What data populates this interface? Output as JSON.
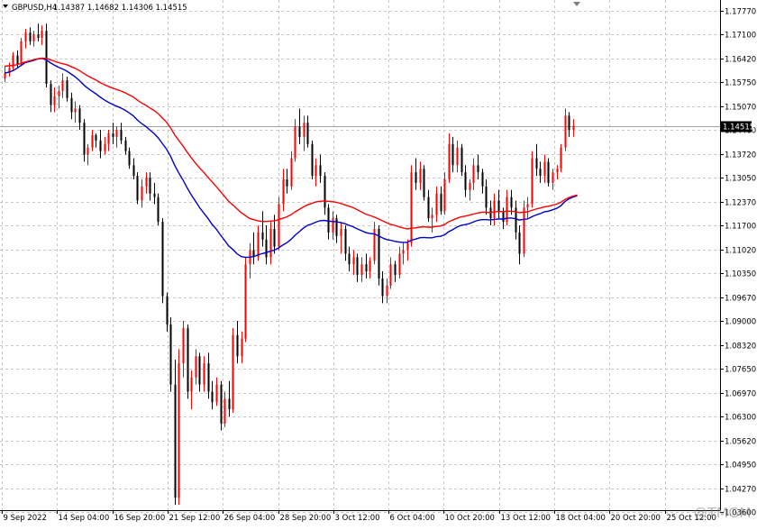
{
  "header": {
    "symbol_timeframe": "GBPUSD,H4",
    "ohlc": "1.14387 1.14682 1.14306 1.14515"
  },
  "watermark": "@TMGM",
  "colors": {
    "bull_candle": "#ff0000",
    "bear_candle": "#000000",
    "ma_fast": "#0000cc",
    "ma_slow": "#ff0000",
    "grid": "#c8c8c8",
    "price_line": "#a0a0a0",
    "price_label_bg": "#000000",
    "price_label_text": "#ffffff"
  },
  "chart_data": {
    "type": "candlestick",
    "symbol": "GBPUSD",
    "timeframe": "H4",
    "current_price": 1.14515,
    "price_label": "1.14515",
    "ylim": [
      1.0365,
      1.1807
    ],
    "y_ticks": [
      "1.17770",
      "1.17100",
      "1.16420",
      "1.15750",
      "1.15070",
      "1.14400",
      "1.13720",
      "1.13050",
      "1.12370",
      "1.11700",
      "1.11020",
      "1.10350",
      "1.09670",
      "1.09000",
      "1.08320",
      "1.07650",
      "1.06970",
      "1.06300",
      "1.05620",
      "1.04950",
      "1.04270",
      "1.03600"
    ],
    "x_labels": [
      "9 Sep 2022",
      "14 Sep 04:00",
      "16 Sep 20:00",
      "21 Sep 12:00",
      "26 Sep 04:00",
      "28 Sep 20:00",
      "3 Oct 12:00",
      "6 Oct 04:00",
      "10 Oct 20:00",
      "13 Oct 12:00",
      "18 Oct 04:00",
      "20 Oct 20:00",
      "25 Oct 12:00"
    ],
    "grid": true,
    "candle_count": 156,
    "candles": [
      [
        1.1585,
        1.162,
        1.1575,
        1.16
      ],
      [
        1.16,
        1.163,
        1.159,
        1.1615
      ],
      [
        1.1615,
        1.166,
        1.161,
        1.165
      ],
      [
        1.165,
        1.1665,
        1.1615,
        1.1625
      ],
      [
        1.1625,
        1.17,
        1.162,
        1.169
      ],
      [
        1.169,
        1.1725,
        1.167,
        1.1715
      ],
      [
        1.1715,
        1.173,
        1.168,
        1.169
      ],
      [
        1.169,
        1.172,
        1.1675,
        1.171
      ],
      [
        1.171,
        1.174,
        1.169,
        1.17
      ],
      [
        1.17,
        1.1735,
        1.168,
        1.172
      ],
      [
        1.172,
        1.174,
        1.156,
        1.157
      ],
      [
        1.157,
        1.158,
        1.149,
        1.151
      ],
      [
        1.151,
        1.156,
        1.149,
        1.1535
      ],
      [
        1.1535,
        1.1565,
        1.15,
        1.155
      ],
      [
        1.155,
        1.16,
        1.153,
        1.158
      ],
      [
        1.158,
        1.159,
        1.152,
        1.153
      ],
      [
        1.153,
        1.1545,
        1.147,
        1.149
      ],
      [
        1.149,
        1.152,
        1.146,
        1.15
      ],
      [
        1.15,
        1.151,
        1.144,
        1.146
      ],
      [
        1.146,
        1.147,
        1.135,
        1.137
      ],
      [
        1.137,
        1.14,
        1.134,
        1.139
      ],
      [
        1.139,
        1.144,
        1.138,
        1.1425
      ],
      [
        1.1425,
        1.143,
        1.139,
        1.141
      ],
      [
        1.141,
        1.144,
        1.136,
        1.138
      ],
      [
        1.138,
        1.142,
        1.137,
        1.14
      ],
      [
        1.14,
        1.144,
        1.138,
        1.143
      ],
      [
        1.143,
        1.146,
        1.14,
        1.142
      ],
      [
        1.142,
        1.145,
        1.139,
        1.144
      ],
      [
        1.144,
        1.146,
        1.14,
        1.141
      ],
      [
        1.141,
        1.142,
        1.137,
        1.138
      ],
      [
        1.138,
        1.139,
        1.133,
        1.134
      ],
      [
        1.134,
        1.136,
        1.13,
        1.131
      ],
      [
        1.131,
        1.132,
        1.123,
        1.124
      ],
      [
        1.124,
        1.13,
        1.122,
        1.128
      ],
      [
        1.128,
        1.132,
        1.126,
        1.1305
      ],
      [
        1.1305,
        1.132,
        1.124,
        1.126
      ],
      [
        1.126,
        1.129,
        1.123,
        1.125
      ],
      [
        1.125,
        1.126,
        1.117,
        1.118
      ],
      [
        1.118,
        1.119,
        1.095,
        1.097
      ],
      [
        1.097,
        1.098,
        1.087,
        1.089
      ],
      [
        1.089,
        1.091,
        1.07,
        1.072
      ],
      [
        1.072,
        1.079,
        1.038,
        1.04
      ],
      [
        1.04,
        1.082,
        1.038,
        1.078
      ],
      [
        1.078,
        1.09,
        1.074,
        1.088
      ],
      [
        1.088,
        1.089,
        1.068,
        1.07
      ],
      [
        1.07,
        1.076,
        1.065,
        1.074
      ],
      [
        1.074,
        1.082,
        1.072,
        1.08
      ],
      [
        1.08,
        1.081,
        1.07,
        1.072
      ],
      [
        1.072,
        1.08,
        1.07,
        1.078
      ],
      [
        1.078,
        1.081,
        1.068,
        1.07
      ],
      [
        1.07,
        1.073,
        1.065,
        1.067
      ],
      [
        1.067,
        1.074,
        1.066,
        1.072
      ],
      [
        1.072,
        1.073,
        1.059,
        1.061
      ],
      [
        1.061,
        1.07,
        1.06,
        1.068
      ],
      [
        1.068,
        1.073,
        1.063,
        1.065
      ],
      [
        1.065,
        1.088,
        1.064,
        1.086
      ],
      [
        1.086,
        1.09,
        1.078,
        1.08
      ],
      [
        1.08,
        1.087,
        1.078,
        1.085
      ],
      [
        1.085,
        1.108,
        1.084,
        1.106
      ],
      [
        1.106,
        1.112,
        1.102,
        1.11
      ],
      [
        1.11,
        1.115,
        1.106,
        1.108
      ],
      [
        1.108,
        1.117,
        1.107,
        1.115
      ],
      [
        1.115,
        1.121,
        1.111,
        1.113
      ],
      [
        1.113,
        1.117,
        1.106,
        1.108
      ],
      [
        1.108,
        1.118,
        1.106,
        1.116
      ],
      [
        1.116,
        1.12,
        1.109,
        1.111
      ],
      [
        1.111,
        1.125,
        1.11,
        1.123
      ],
      [
        1.123,
        1.133,
        1.121,
        1.13
      ],
      [
        1.13,
        1.133,
        1.126,
        1.128
      ],
      [
        1.128,
        1.138,
        1.127,
        1.136
      ],
      [
        1.136,
        1.147,
        1.135,
        1.145
      ],
      [
        1.145,
        1.15,
        1.14,
        1.142
      ],
      [
        1.142,
        1.148,
        1.138,
        1.146
      ],
      [
        1.146,
        1.148,
        1.139,
        1.14
      ],
      [
        1.14,
        1.141,
        1.13,
        1.131
      ],
      [
        1.131,
        1.136,
        1.128,
        1.134
      ],
      [
        1.134,
        1.137,
        1.129,
        1.131
      ],
      [
        1.131,
        1.132,
        1.12,
        1.122
      ],
      [
        1.122,
        1.123,
        1.113,
        1.115
      ],
      [
        1.115,
        1.121,
        1.113,
        1.119
      ],
      [
        1.119,
        1.12,
        1.112,
        1.114
      ],
      [
        1.114,
        1.118,
        1.109,
        1.116
      ],
      [
        1.116,
        1.117,
        1.107,
        1.109
      ],
      [
        1.109,
        1.111,
        1.104,
        1.106
      ],
      [
        1.106,
        1.11,
        1.103,
        1.108
      ],
      [
        1.108,
        1.109,
        1.101,
        1.103
      ],
      [
        1.103,
        1.108,
        1.101,
        1.106
      ],
      [
        1.106,
        1.109,
        1.102,
        1.104
      ],
      [
        1.104,
        1.108,
        1.102,
        1.107
      ],
      [
        1.107,
        1.118,
        1.106,
        1.116
      ],
      [
        1.116,
        1.117,
        1.1,
        1.102
      ],
      [
        1.102,
        1.104,
        1.095,
        1.097
      ],
      [
        1.097,
        1.102,
        1.095,
        1.1
      ],
      [
        1.1,
        1.108,
        1.099,
        1.106
      ],
      [
        1.106,
        1.107,
        1.101,
        1.103
      ],
      [
        1.103,
        1.111,
        1.102,
        1.109
      ],
      [
        1.109,
        1.112,
        1.106,
        1.11
      ],
      [
        1.11,
        1.113,
        1.107,
        1.112
      ],
      [
        1.112,
        1.134,
        1.111,
        1.132
      ],
      [
        1.132,
        1.136,
        1.127,
        1.129
      ],
      [
        1.129,
        1.135,
        1.127,
        1.133
      ],
      [
        1.133,
        1.134,
        1.124,
        1.125
      ],
      [
        1.125,
        1.127,
        1.118,
        1.119
      ],
      [
        1.119,
        1.122,
        1.115,
        1.12
      ],
      [
        1.12,
        1.128,
        1.118,
        1.126
      ],
      [
        1.126,
        1.128,
        1.12,
        1.121
      ],
      [
        1.121,
        1.132,
        1.12,
        1.13
      ],
      [
        1.13,
        1.143,
        1.129,
        1.14
      ],
      [
        1.14,
        1.142,
        1.132,
        1.134
      ],
      [
        1.134,
        1.141,
        1.132,
        1.139
      ],
      [
        1.139,
        1.14,
        1.131,
        1.132
      ],
      [
        1.132,
        1.134,
        1.125,
        1.127
      ],
      [
        1.127,
        1.13,
        1.124,
        1.129
      ],
      [
        1.129,
        1.136,
        1.127,
        1.134
      ],
      [
        1.134,
        1.137,
        1.13,
        1.132
      ],
      [
        1.132,
        1.133,
        1.126,
        1.128
      ],
      [
        1.128,
        1.13,
        1.12,
        1.122
      ],
      [
        1.122,
        1.124,
        1.117,
        1.119
      ],
      [
        1.119,
        1.126,
        1.117,
        1.124
      ],
      [
        1.124,
        1.127,
        1.119,
        1.121
      ],
      [
        1.121,
        1.122,
        1.116,
        1.118
      ],
      [
        1.118,
        1.127,
        1.117,
        1.125
      ],
      [
        1.125,
        1.127,
        1.12,
        1.122
      ],
      [
        1.122,
        1.124,
        1.113,
        1.115
      ],
      [
        1.115,
        1.117,
        1.106,
        1.109
      ],
      [
        1.109,
        1.124,
        1.108,
        1.122
      ],
      [
        1.122,
        1.125,
        1.119,
        1.123
      ],
      [
        1.123,
        1.138,
        1.122,
        1.136
      ],
      [
        1.136,
        1.14,
        1.131,
        1.133
      ],
      [
        1.133,
        1.135,
        1.129,
        1.131
      ],
      [
        1.131,
        1.137,
        1.129,
        1.135
      ],
      [
        1.135,
        1.136,
        1.128,
        1.129
      ],
      [
        1.129,
        1.133,
        1.127,
        1.132
      ],
      [
        1.132,
        1.134,
        1.13,
        1.133
      ],
      [
        1.133,
        1.14,
        1.132,
        1.139
      ],
      [
        1.139,
        1.15,
        1.138,
        1.148
      ],
      [
        1.148,
        1.149,
        1.142,
        1.144
      ],
      [
        1.144,
        1.147,
        1.142,
        1.1452
      ]
    ],
    "series": [
      {
        "type": "line",
        "color": "#0000cc",
        "values": [
          1.16,
          1.1603,
          1.1607,
          1.1614,
          1.1622,
          1.163,
          1.1633,
          1.1636,
          1.164,
          1.1642,
          1.1638,
          1.163,
          1.1623,
          1.1617,
          1.1612,
          1.1606,
          1.1598,
          1.159,
          1.158,
          1.1568,
          1.1558,
          1.155,
          1.1542,
          1.1533,
          1.1525,
          1.1518,
          1.1512,
          1.1507,
          1.1502,
          1.1496,
          1.1488,
          1.148,
          1.1468,
          1.1458,
          1.145,
          1.144,
          1.143,
          1.1418,
          1.1402,
          1.1386,
          1.1366,
          1.134,
          1.1318,
          1.1298,
          1.1276,
          1.1256,
          1.1238,
          1.122,
          1.1205,
          1.119,
          1.1173,
          1.116,
          1.1143,
          1.1128,
          1.1112,
          1.1102,
          1.109,
          1.1082,
          1.108,
          1.108,
          1.1082,
          1.1086,
          1.109,
          1.1093,
          1.1097,
          1.11,
          1.1106,
          1.1114,
          1.1121,
          1.113,
          1.1142,
          1.1152,
          1.1162,
          1.117,
          1.1174,
          1.1179,
          1.1183,
          1.1184,
          1.1182,
          1.1181,
          1.118,
          1.1178,
          1.1175,
          1.117,
          1.1166,
          1.116,
          1.1155,
          1.115,
          1.1147,
          1.1146,
          1.1141,
          1.1135,
          1.113,
          1.1128,
          1.1125,
          1.1123,
          1.1122,
          1.1122,
          1.1128,
          1.1131,
          1.1135,
          1.1136,
          1.1135,
          1.1135,
          1.1138,
          1.1139,
          1.1143,
          1.1152,
          1.1158,
          1.1165,
          1.117,
          1.1172,
          1.1175,
          1.118,
          1.1184,
          1.1186,
          1.1186,
          1.1185,
          1.1187,
          1.1188,
          1.1188,
          1.119,
          1.1191,
          1.1189,
          1.1185,
          1.1187,
          1.1188,
          1.1194,
          1.1199,
          1.1203,
          1.1208,
          1.121,
          1.1214,
          1.1218,
          1.1225,
          1.1237,
          1.1245,
          1.125,
          1.1254
        ]
      },
      {
        "type": "line",
        "color": "#ff0000",
        "values": [
          1.162,
          1.1621,
          1.1622,
          1.1624,
          1.1628,
          1.1632,
          1.1635,
          1.1638,
          1.1641,
          1.1643,
          1.1642,
          1.1638,
          1.1634,
          1.163,
          1.1627,
          1.1624,
          1.1619,
          1.1614,
          1.1608,
          1.16,
          1.1593,
          1.1587,
          1.1581,
          1.1574,
          1.1568,
          1.1563,
          1.1558,
          1.1554,
          1.155,
          1.1545,
          1.1539,
          1.1533,
          1.1524,
          1.1516,
          1.151,
          1.1502,
          1.1495,
          1.1486,
          1.1474,
          1.1462,
          1.1446,
          1.1426,
          1.141,
          1.1394,
          1.1377,
          1.1361,
          1.1346,
          1.1332,
          1.132,
          1.1306,
          1.1293,
          1.128,
          1.1266,
          1.1252,
          1.1238,
          1.1228,
          1.1217,
          1.1206,
          1.1198,
          1.119,
          1.1186,
          1.1183,
          1.1181,
          1.1181,
          1.1182,
          1.1183,
          1.1186,
          1.119,
          1.1194,
          1.12,
          1.1208,
          1.1215,
          1.1222,
          1.1228,
          1.1232,
          1.1236,
          1.1238,
          1.1239,
          1.1238,
          1.1237,
          1.1235,
          1.1232,
          1.1228,
          1.1224,
          1.122,
          1.1214,
          1.1208,
          1.1202,
          1.1198,
          1.1194,
          1.1189,
          1.1183,
          1.1178,
          1.1173,
          1.117,
          1.1166,
          1.1163,
          1.116,
          1.1162,
          1.1163,
          1.1165,
          1.1166,
          1.1165,
          1.1165,
          1.1167,
          1.1168,
          1.1172,
          1.118,
          1.1185,
          1.119,
          1.1194,
          1.1196,
          1.1199,
          1.1202,
          1.1205,
          1.1207,
          1.1207,
          1.1206,
          1.1208,
          1.1209,
          1.1209,
          1.121,
          1.121,
          1.1209,
          1.1206,
          1.1207,
          1.1208,
          1.1212,
          1.1216,
          1.1219,
          1.1222,
          1.1224,
          1.1227,
          1.123,
          1.1235,
          1.1243,
          1.1249,
          1.1253,
          1.1256
        ]
      }
    ]
  }
}
